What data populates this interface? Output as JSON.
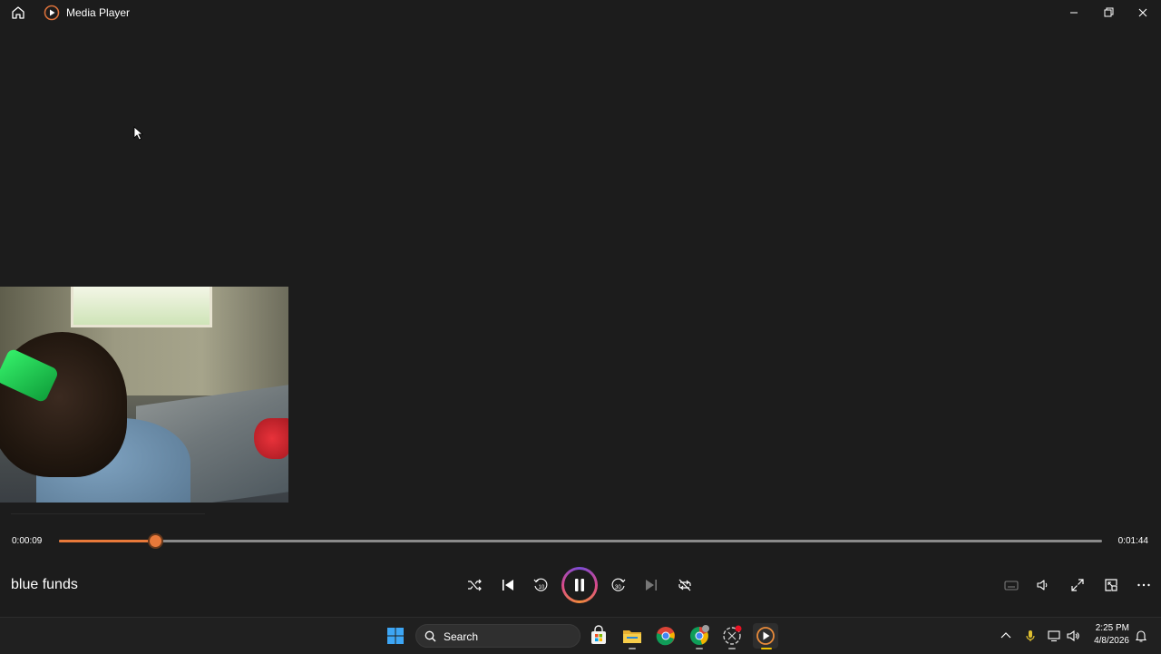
{
  "window": {
    "title": "Media Player",
    "controls": [
      "minimize",
      "maximize",
      "close"
    ]
  },
  "video": {
    "description_icon": "video-frame"
  },
  "playback": {
    "current_time": "0:00:09",
    "total_time": "0:01:44",
    "progress_fraction": 0.092,
    "state": "playing"
  },
  "track": {
    "title": "blue funds"
  },
  "controls": {
    "icons": [
      "shuffle-icon",
      "previous-icon",
      "skip-back-10-icon",
      "pause-icon",
      "skip-forward-30-icon",
      "next-icon",
      "repeat-icon",
      "captions-icon",
      "volume-icon",
      "fullscreen-icon",
      "miniplayer-icon",
      "more-icon"
    ]
  },
  "taskbar": {
    "search_label": "Search",
    "apps": [
      "store-icon",
      "file-explorer-icon",
      "chrome-icon",
      "chrome-profile-icon",
      "hub-icon",
      "media-player-icon"
    ],
    "clock_time": "2:25 PM",
    "clock_date": "4/8/2026"
  },
  "colors": {
    "background": "#1c1c1c",
    "accent": "#e8793a",
    "taskbar": "#202020"
  }
}
